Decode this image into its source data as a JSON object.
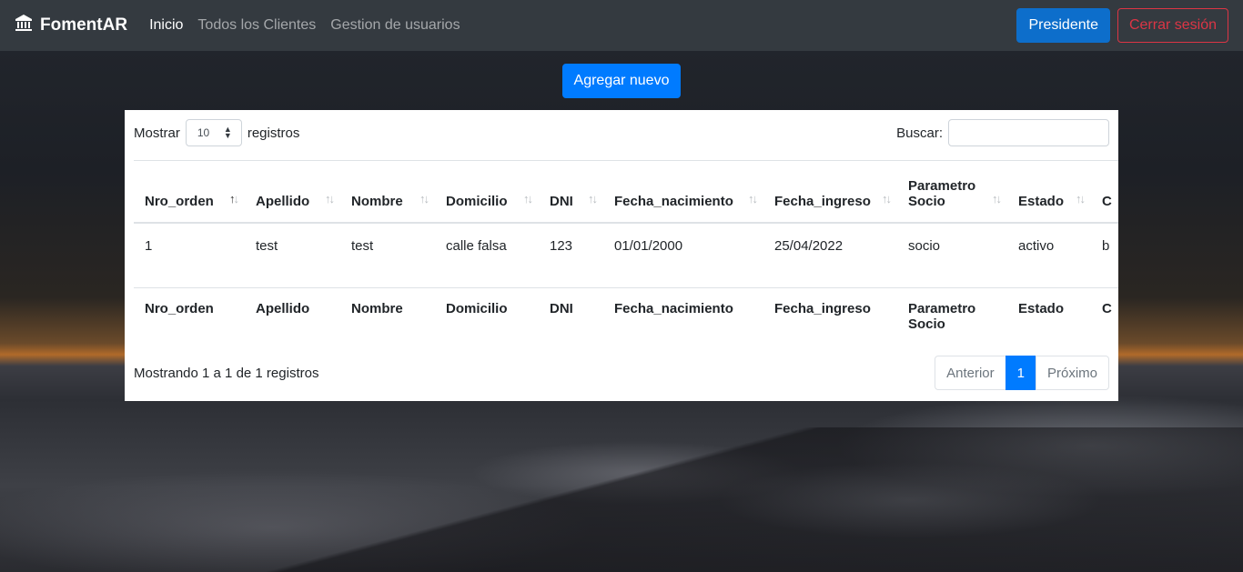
{
  "navbar": {
    "brand": "FomentAR",
    "links": [
      "Inicio",
      "Todos los Clientes",
      "Gestion de usuarios"
    ],
    "role_button": "Presidente",
    "logout_button": "Cerrar sesión"
  },
  "actions": {
    "add_button": "Agregar nuevo"
  },
  "table_controls": {
    "show_label": "Mostrar",
    "show_value": "10",
    "records_label": "registros",
    "search_label": "Buscar:",
    "search_value": ""
  },
  "table": {
    "columns": [
      "Nro_orden",
      "Apellido",
      "Nombre",
      "Domicilio",
      "DNI",
      "Fecha_nacimiento",
      "Fecha_ingreso",
      "Parametro Socio",
      "Estado",
      "C"
    ],
    "rows": [
      [
        "1",
        "test",
        "test",
        "calle falsa",
        "123",
        "01/01/2000",
        "25/04/2022",
        "socio",
        "activo",
        "b"
      ]
    ]
  },
  "footer": {
    "info": "Mostrando 1 a 1 de 1 registros",
    "prev": "Anterior",
    "page": "1",
    "next": "Próximo"
  },
  "colors": {
    "navbar": "#343a40",
    "primary": "#007bff",
    "danger": "#dc3545"
  }
}
